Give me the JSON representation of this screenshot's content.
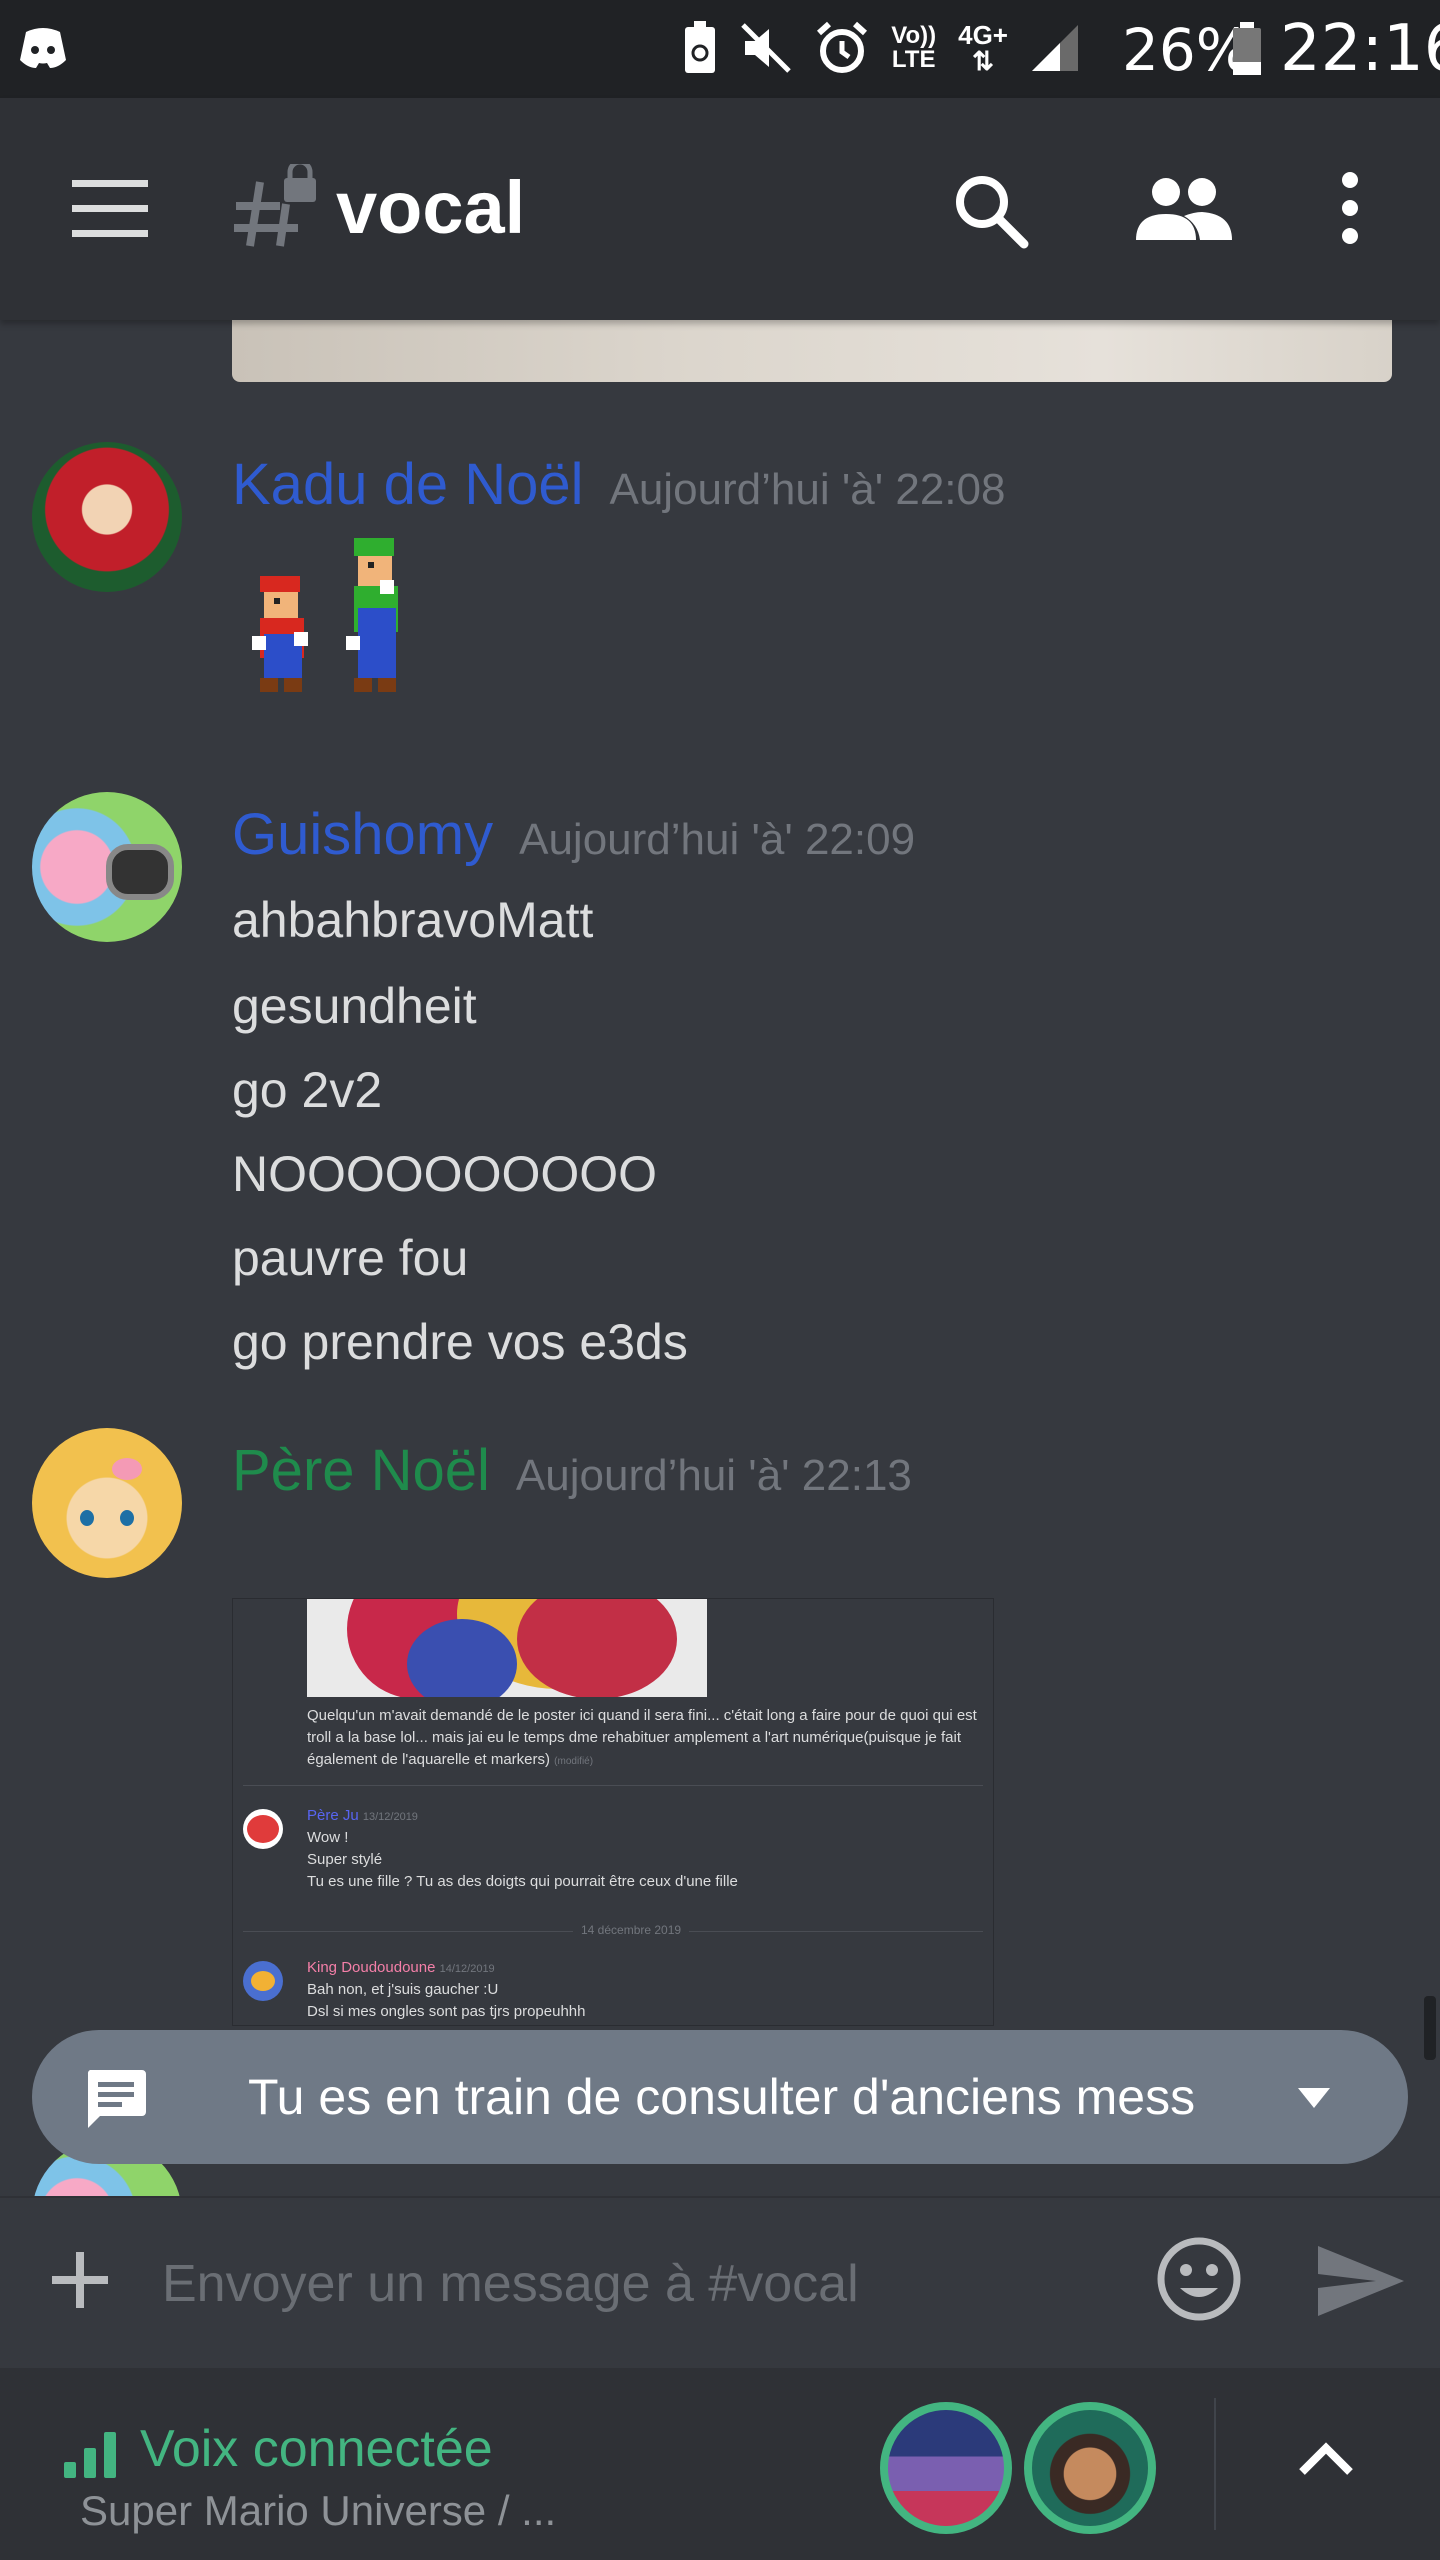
{
  "status_bar": {
    "icons": [
      "discord-icon",
      "recycle-battery-icon",
      "mute-icon",
      "alarm-icon",
      "volte-icon",
      "4g-icon",
      "signal-icon"
    ],
    "volte_label": "Vo))\nLTE",
    "network_label": "4G+",
    "battery": "26%",
    "time": "22:16"
  },
  "header": {
    "channel_name": "vocal",
    "icons": [
      "hamburger-menu-icon",
      "locked-channel-hash-icon",
      "search-icon",
      "members-icon",
      "more-vertical-icon"
    ]
  },
  "messages": [
    {
      "author": "Kadu de Noël",
      "author_color": "#2f5bd0",
      "timestamp": "Aujourd’hui 'à' 22:08",
      "content": []
    },
    {
      "author": "Guishomy",
      "author_color": "#2f5bd0",
      "timestamp": "Aujourd’hui 'à' 22:09",
      "content": [
        "ahbahbravoMatt",
        "gesundheit",
        "go 2v2",
        "NOOOOOOOOOO",
        "pauvre fou",
        "go prendre vos e3ds"
      ]
    },
    {
      "author": "Père Noël",
      "author_color": "#1f8b4c",
      "timestamp": "Aujourd’hui 'à' 22:13",
      "content": []
    }
  ],
  "attachment": {
    "caption": "Quelqu'un m'avait demandé de le poster ici quand il sera fini... c'était long a faire pour de quoi qui est",
    "caption2": "troll a la base lol... mais jai eu le temps dme rehabituer amplement a l'art numérique(puisque je fait",
    "caption3": "également de l'aquarelle et markers)",
    "edited": "(modifié)",
    "reply1_author": "Père Ju",
    "reply1_date": "13/12/2019",
    "reply1_lines": [
      "Wow !",
      "Super stylé",
      "Tu es une fille ? Tu as des doigts qui pourrait être ceux d'une fille"
    ],
    "day_divider": "14 décembre 2019",
    "reply2_author": "King Doudoudoune",
    "reply2_date": "14/12/2019",
    "reply2_lines": [
      "Bah non, et j'suis gaucher :U",
      "Dsl si mes ongles sont pas tjrs propeuhhh"
    ]
  },
  "banner": {
    "text": "Tu es en train de consulter d'anciens mess",
    "icon": "chat-bubble-icon"
  },
  "input": {
    "placeholder": "Envoyer un message à #vocal",
    "value": ""
  },
  "voice": {
    "status": "Voix connectée",
    "channel": "Super Mario Universe / ...",
    "accent": "#43b581"
  }
}
